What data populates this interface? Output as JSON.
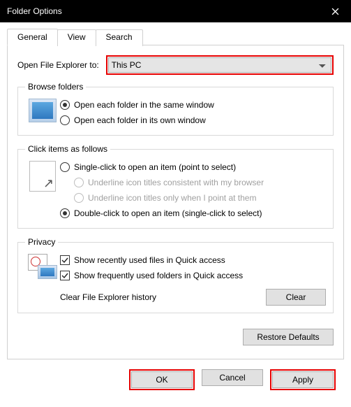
{
  "window": {
    "title": "Folder Options"
  },
  "tabs": {
    "general": "General",
    "view": "View",
    "search": "Search"
  },
  "open_to": {
    "label": "Open File Explorer to:",
    "value": "This PC"
  },
  "browse": {
    "legend": "Browse folders",
    "same": "Open each folder in the same window",
    "own": "Open each folder in its own window"
  },
  "click": {
    "legend": "Click items as follows",
    "single": "Single-click to open an item (point to select)",
    "ul_browser": "Underline icon titles consistent with my browser",
    "ul_point": "Underline icon titles only when I point at them",
    "double": "Double-click to open an item (single-click to select)"
  },
  "privacy": {
    "legend": "Privacy",
    "recent_files": "Show recently used files in Quick access",
    "freq_folders": "Show frequently used folders in Quick access",
    "clear_label": "Clear File Explorer history",
    "clear_btn": "Clear"
  },
  "restore": "Restore Defaults",
  "buttons": {
    "ok": "OK",
    "cancel": "Cancel",
    "apply": "Apply"
  }
}
